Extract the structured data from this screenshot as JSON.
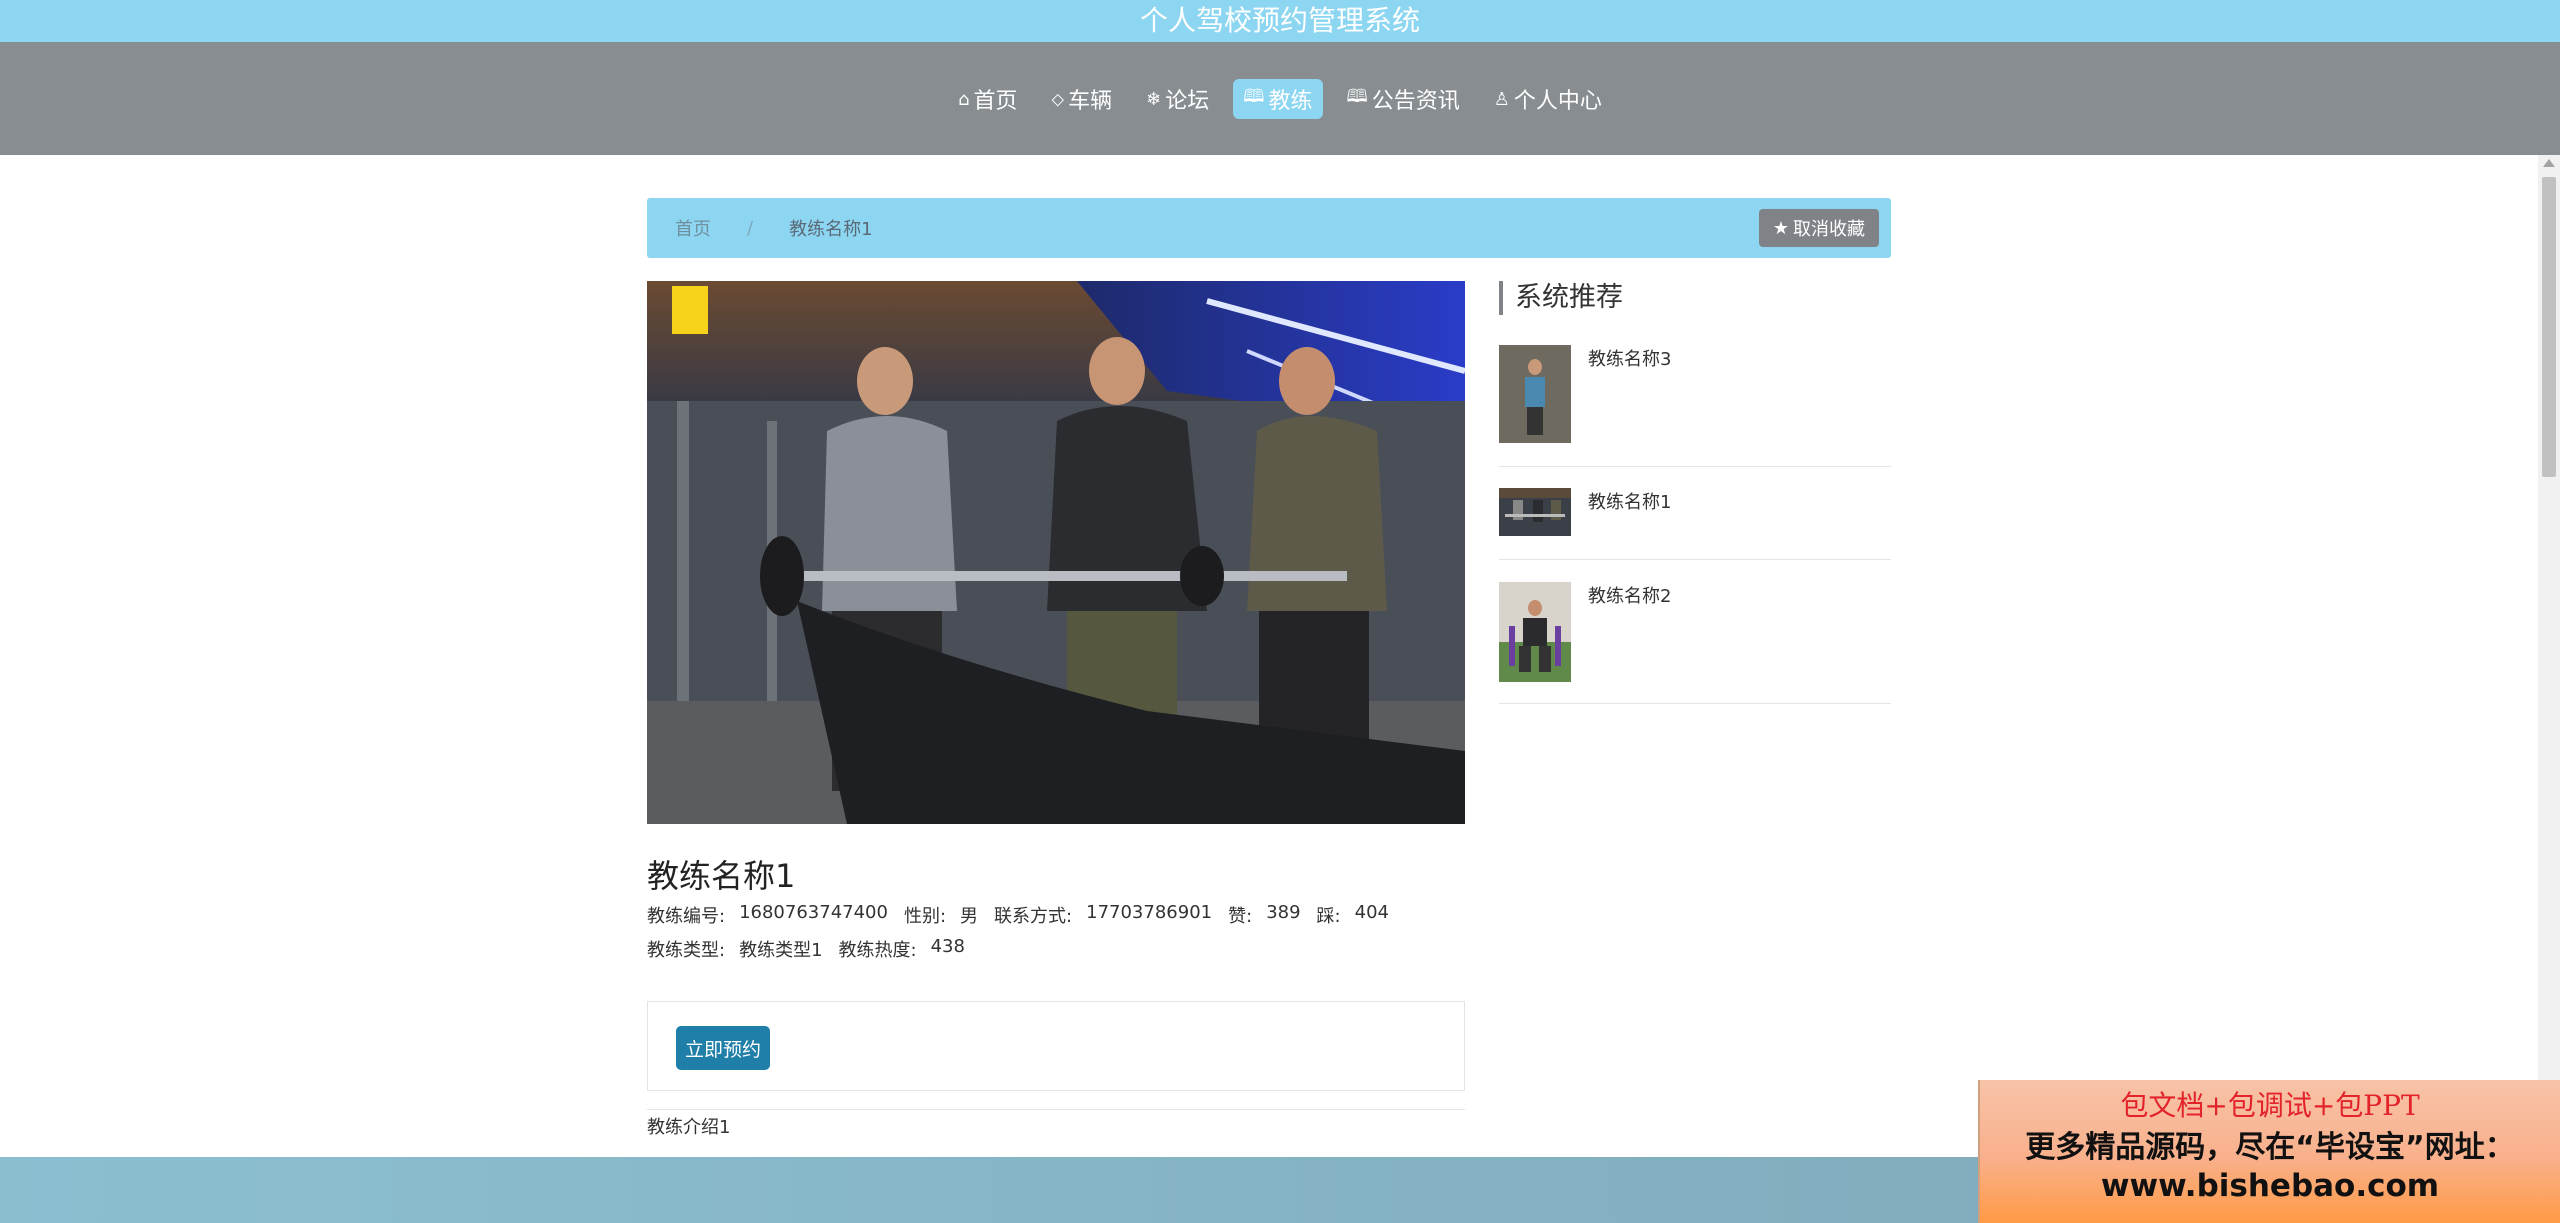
{
  "app": {
    "title": "个人驾校预约管理系统"
  },
  "nav": {
    "items": [
      {
        "icon": "home-icon",
        "glyph": "⌂",
        "label": "首页",
        "active": false
      },
      {
        "icon": "tag-icon",
        "glyph": "⬦",
        "label": "车辆",
        "active": false
      },
      {
        "icon": "snowflake-icon",
        "glyph": "❄",
        "label": "论坛",
        "active": false
      },
      {
        "icon": "book-icon",
        "glyph": "🕮",
        "label": "教练",
        "active": true
      },
      {
        "icon": "book-open-icon",
        "glyph": "🕮",
        "label": "公告资讯",
        "active": false
      },
      {
        "icon": "user-icon",
        "glyph": "♙",
        "label": "个人中心",
        "active": false
      }
    ]
  },
  "breadcrumb": {
    "home": "首页",
    "separator": "/",
    "current": "教练名称1"
  },
  "favorite": {
    "icon": "star-icon",
    "label": "取消收藏"
  },
  "coach": {
    "name": "教练名称1",
    "fields_row1": [
      {
        "label": "教练编号:",
        "value": "1680763747400"
      },
      {
        "label": "性别:",
        "value": "男"
      },
      {
        "label": "联系方式:",
        "value": "17703786901"
      },
      {
        "label": "赞:",
        "value": "389"
      },
      {
        "label": "踩:",
        "value": "404"
      }
    ],
    "fields_row2": [
      {
        "label": "教练类型:",
        "value": "教练类型1"
      },
      {
        "label": "教练热度:",
        "value": "438"
      }
    ],
    "book_label": "立即预约",
    "intro": "教练介绍1"
  },
  "sidebar": {
    "title": "系统推荐",
    "items": [
      {
        "name": "教练名称3"
      },
      {
        "name": "教练名称1"
      },
      {
        "name": "教练名称2"
      }
    ]
  },
  "promo": {
    "line1": "包文档+包调试+包PPT",
    "line2": "更多精品源码，尽在“毕设宝”网址：",
    "line3": "www.bishebao.com"
  },
  "colors": {
    "accent": "#8dd6f2",
    "nav_bg": "#878d91",
    "button": "#1f7fa8"
  }
}
